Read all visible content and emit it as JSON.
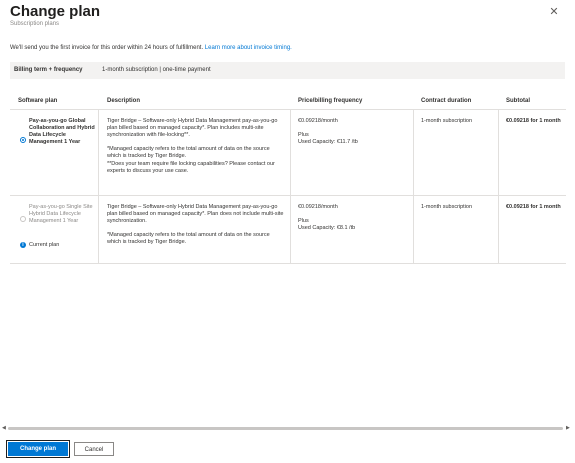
{
  "dialog": {
    "title": "Change plan",
    "subtitle": "Subscription plans",
    "close_icon": "close-icon"
  },
  "note": {
    "text": "We'll send you the first invoice for this order within 24 hours of fulfillment.",
    "link": "Learn more about invoice timing."
  },
  "billing": {
    "label": "Billing term + frequency",
    "value": "1-month subscription | one-time payment"
  },
  "table": {
    "headers": [
      "Software plan",
      "Description",
      "Price/billing frequency",
      "Contract duration",
      "Subtotal"
    ],
    "rows": [
      {
        "selected": true,
        "plan": "Pay-as-you-go Global Collaboration and Hybrid Data Lifecycle Management 1 Year",
        "desc1": "Tiger Bridge – Software-only Hybrid Data Management pay-as-you-go plan billed based on managed capacity*. Plan includes multi-site synchronization with file-locking**.",
        "desc2": "*Managed capacity refers to the total amount of data on the source which is tracked by Tiger Bridge.",
        "desc3": "**Does your team require file locking capabilities? Please contact our experts to discuss your use case.",
        "price": "€0.09218/month",
        "plus": "Plus",
        "capacity": "Used Capacity: €11.7 /tb",
        "duration": "1-month subscription",
        "subtotal": "€0.09218 for 1 month"
      },
      {
        "selected": false,
        "plan": "Pay-as-you-go Single Site Hybrid Data Lifecycle Management 1 Year",
        "current": "Current plan",
        "desc1": "Tiger Bridge – Software-only Hybrid Data Management pay-as-you-go plan billed based on managed capacity*. Plan does not include multi-site synchronization.",
        "desc2": "*Managed capacity refers to the total amount of data on the source which is tracked by Tiger Bridge.",
        "price": "€0.09218/month",
        "plus": "Plus",
        "capacity": "Used Capacity: €8.1 /tb",
        "duration": "1-month subscription",
        "subtotal": "€0.09218 for 1 month"
      }
    ]
  },
  "buttons": {
    "primary": "Change plan",
    "secondary": "Cancel"
  },
  "colors": {
    "accent": "#0078d4",
    "billing_bg": "#f3f2f1"
  }
}
